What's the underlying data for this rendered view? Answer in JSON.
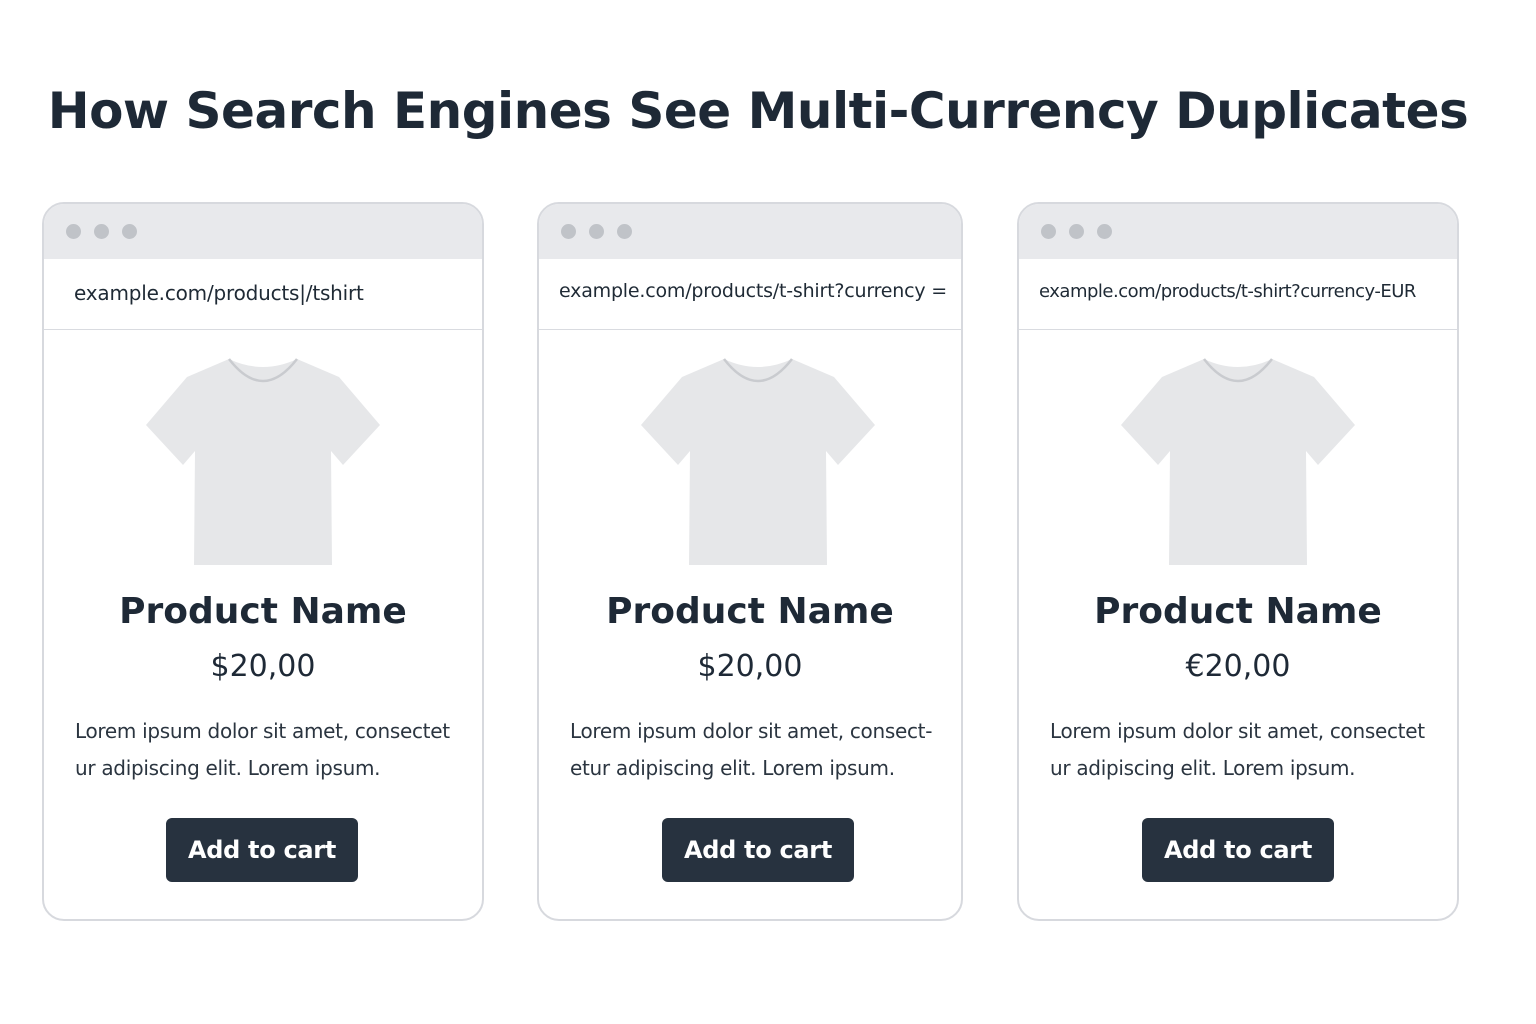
{
  "title": "How Search Engines See Multi-Currency Duplicates",
  "colors": {
    "title_text": "#1e2936",
    "button_bg": "#27323f",
    "button_text": "#ffffff",
    "titlebar_bg": "#e8e9ec",
    "window_dot": "#c0c3c8",
    "card_border": "#d7d9de",
    "tshirt_fill": "#e6e7e9"
  },
  "cards": [
    {
      "url": "example.com/products|/tshirt",
      "image_icon": "tshirt-icon",
      "product_name": "Product Name",
      "price": "$20,00",
      "description_line1": "Lorem ipsum dolor sit amet, consectet",
      "description_line2": "ur adipiscing elit. Lorem ipsum.",
      "button_label": "Add to cart"
    },
    {
      "url": "example.com/products/t-shirt?currency =",
      "image_icon": "tshirt-icon",
      "product_name": "Product Name",
      "price": "$20,00",
      "description_line1": "Lorem ipsum dolor sit amet, consect-",
      "description_line2": "etur adipiscing elit. Lorem ipsum.",
      "button_label": "Add to cart"
    },
    {
      "url": "example.com/products/t-shirt?currency-EUR",
      "image_icon": "tshirt-icon",
      "product_name": "Product Name",
      "price": "€20,00",
      "description_line1": "Lorem ipsum dolor sit amet, consectet",
      "description_line2": "ur adipiscing elit. Lorem ipsum.",
      "button_label": "Add to cart"
    }
  ]
}
